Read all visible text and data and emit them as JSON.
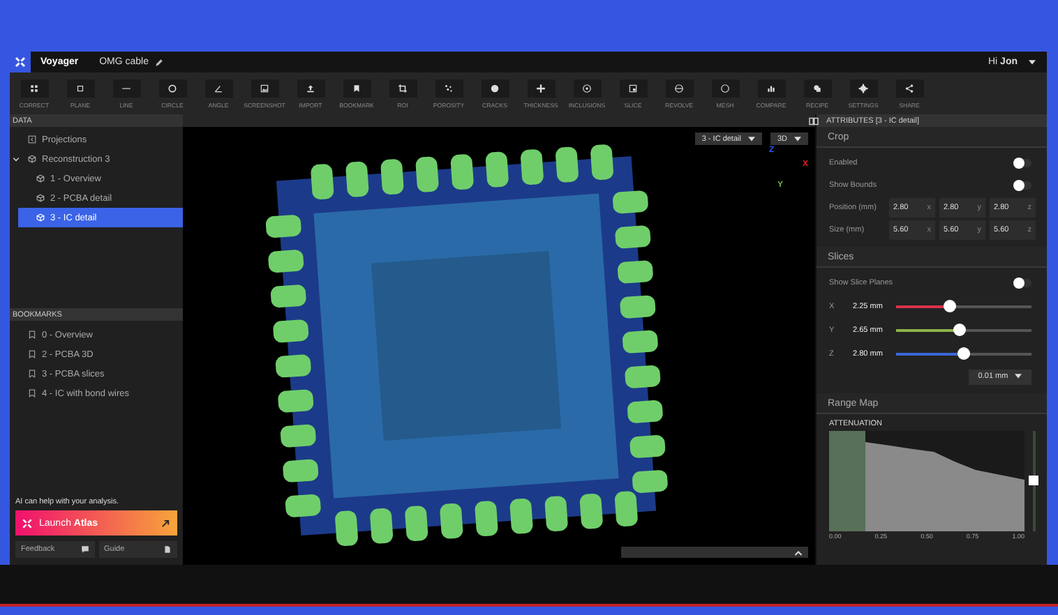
{
  "app": {
    "name": "Voyager",
    "document": "OMG cable",
    "greeting": "Hi",
    "user": "Jon"
  },
  "toolbar": [
    {
      "label": "CORRECT"
    },
    {
      "label": "PLANE"
    },
    {
      "label": "LINE"
    },
    {
      "label": "CIRCLE"
    },
    {
      "label": "ANGLE"
    },
    {
      "label": "SCREENSHOT"
    },
    {
      "label": "IMPORT"
    },
    {
      "label": "BOOKMARK"
    },
    {
      "label": "ROI"
    },
    {
      "label": "POROSITY"
    },
    {
      "label": "CRACKS"
    },
    {
      "label": "THICKNESS"
    },
    {
      "label": "INCLUSIONS"
    },
    {
      "label": "SLICE"
    },
    {
      "label": "REVOLVE"
    },
    {
      "label": "MESH"
    },
    {
      "label": "COMPARE"
    },
    {
      "label": "RECIPE"
    },
    {
      "label": "SETTINGS"
    },
    {
      "label": "SHARE"
    }
  ],
  "data_panel": {
    "title": "DATA",
    "tree": [
      {
        "label": "Projections",
        "kind": "image",
        "selected": false
      },
      {
        "label": "Reconstruction 3",
        "kind": "volume",
        "selected": false,
        "expanded": true,
        "children": [
          {
            "label": "1 - Overview",
            "kind": "volume",
            "selected": false
          },
          {
            "label": "2 - PCBA detail",
            "kind": "volume",
            "selected": false
          },
          {
            "label": "3 - IC detail",
            "kind": "volume",
            "selected": true
          }
        ]
      }
    ]
  },
  "bookmarks": {
    "title": "BOOKMARKS",
    "items": [
      "0 - Overview",
      "2 - PCBA 3D",
      "3 - PCBA slices",
      "4 - IC with bond wires"
    ]
  },
  "assistant": {
    "prompt": "AI can help with your analysis.",
    "button": "Launch **Atlas**",
    "links": [
      "Feedback",
      "Guide"
    ]
  },
  "viewport": {
    "view_select": "3 - IC detail",
    "mode_select": "3D",
    "axes": [
      "Z",
      "X",
      "Y"
    ]
  },
  "attributes": {
    "title": "ATTRIBUTES [3 - IC detail]",
    "crop": {
      "title": "Crop",
      "toggles": [
        {
          "label": "Enabled",
          "on": false
        },
        {
          "label": "Show Bounds",
          "on": false
        }
      ],
      "vectors": [
        {
          "label": "Position (mm)",
          "values": [
            {
              "value": "2.80",
              "axis": "x"
            },
            {
              "value": "2.80",
              "axis": "y"
            },
            {
              "value": "2.80",
              "axis": "z"
            }
          ]
        },
        {
          "label": "Size (mm)",
          "values": [
            {
              "value": "5.60",
              "axis": "x"
            },
            {
              "value": "5.60",
              "axis": "y"
            },
            {
              "value": "5.60",
              "axis": "z"
            }
          ]
        }
      ]
    },
    "slices": {
      "title": "Slices",
      "toggle": {
        "label": "Show Slice Planes",
        "on": false
      },
      "sliders": [
        {
          "axis": "X",
          "reading": "2.25 mm",
          "level": 0.4,
          "color": "#d8334a"
        },
        {
          "axis": "Y",
          "reading": "2.65 mm",
          "level": 0.47,
          "color": "#8fb34a"
        },
        {
          "axis": "Z",
          "reading": "2.80 mm",
          "level": 0.5,
          "color": "#3a66d8"
        }
      ],
      "step": "0.01 mm"
    },
    "range_map": {
      "title": "Range Map",
      "chart_title": "ATTENUATION",
      "ticks": [
        "0.00",
        "0.25",
        "0.50",
        "0.75",
        "1.00"
      ],
      "range_slider": {
        "level": 0.5
      }
    }
  }
}
